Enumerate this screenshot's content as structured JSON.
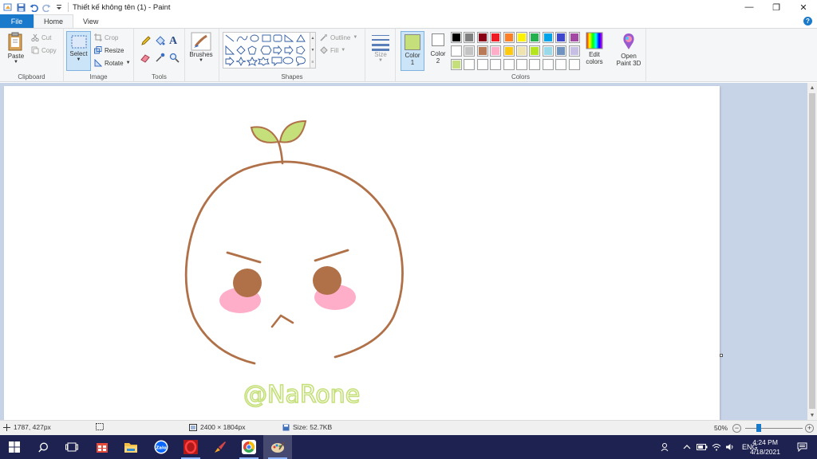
{
  "window": {
    "title": "Thiết kế không tên (1) - Paint",
    "controls": {
      "minimize": "—",
      "restore": "❐",
      "close": "✕"
    }
  },
  "tabs": [
    {
      "label": "File"
    },
    {
      "label": "Home"
    },
    {
      "label": "View"
    }
  ],
  "help_label": "?",
  "ribbon": {
    "clipboard": {
      "label": "Clipboard",
      "paste": "Paste",
      "cut": "Cut",
      "copy": "Copy"
    },
    "image": {
      "label": "Image",
      "select": "Select",
      "crop": "Crop",
      "resize": "Resize",
      "rotate": "Rotate"
    },
    "tools": {
      "label": "Tools"
    },
    "brushes": {
      "label": "Brushes"
    },
    "shapes": {
      "label": "Shapes",
      "outline": "Outline",
      "fill": "Fill"
    },
    "size": {
      "label": "Size"
    },
    "colors": {
      "label": "Colors",
      "color1": "Color",
      "color1_num": "1",
      "color2": "Color",
      "color2_num": "2",
      "color1_value": "#c5e07a",
      "color2_value": "#ffffff",
      "edit": "Edit",
      "edit2": "colors",
      "palette": [
        "#000000",
        "#7f7f7f",
        "#880015",
        "#ed1c24",
        "#ff7f27",
        "#fff200",
        "#22b14c",
        "#00a2e8",
        "#3f48cc",
        "#a349a4",
        "#ffffff",
        "#c3c3c3",
        "#b97a57",
        "#ffaec9",
        "#ffc90e",
        "#efe4b0",
        "#b5e61d",
        "#99d9ea",
        "#7092be",
        "#c8bfe7",
        "#c5e07a",
        "#ffffff",
        "#ffffff",
        "#ffffff",
        "#ffffff",
        "#ffffff",
        "#ffffff",
        "#ffffff",
        "#ffffff",
        "#ffffff"
      ]
    },
    "paint3d": {
      "line1": "Open",
      "line2": "Paint 3D"
    }
  },
  "drawing": {
    "signature": "@NaRone",
    "stroke_color": "#b07048",
    "leaf_color": "#c5e07a",
    "blush_color": "#ffaec9"
  },
  "status": {
    "cursor_pos": "1787, 427px",
    "dimensions": "2400 × 1804px",
    "size": "Size: 52.7KB",
    "zoom": "50%"
  },
  "taskbar": {
    "lang": "ENG",
    "time": "4:24 PM",
    "date": "4/18/2021"
  }
}
